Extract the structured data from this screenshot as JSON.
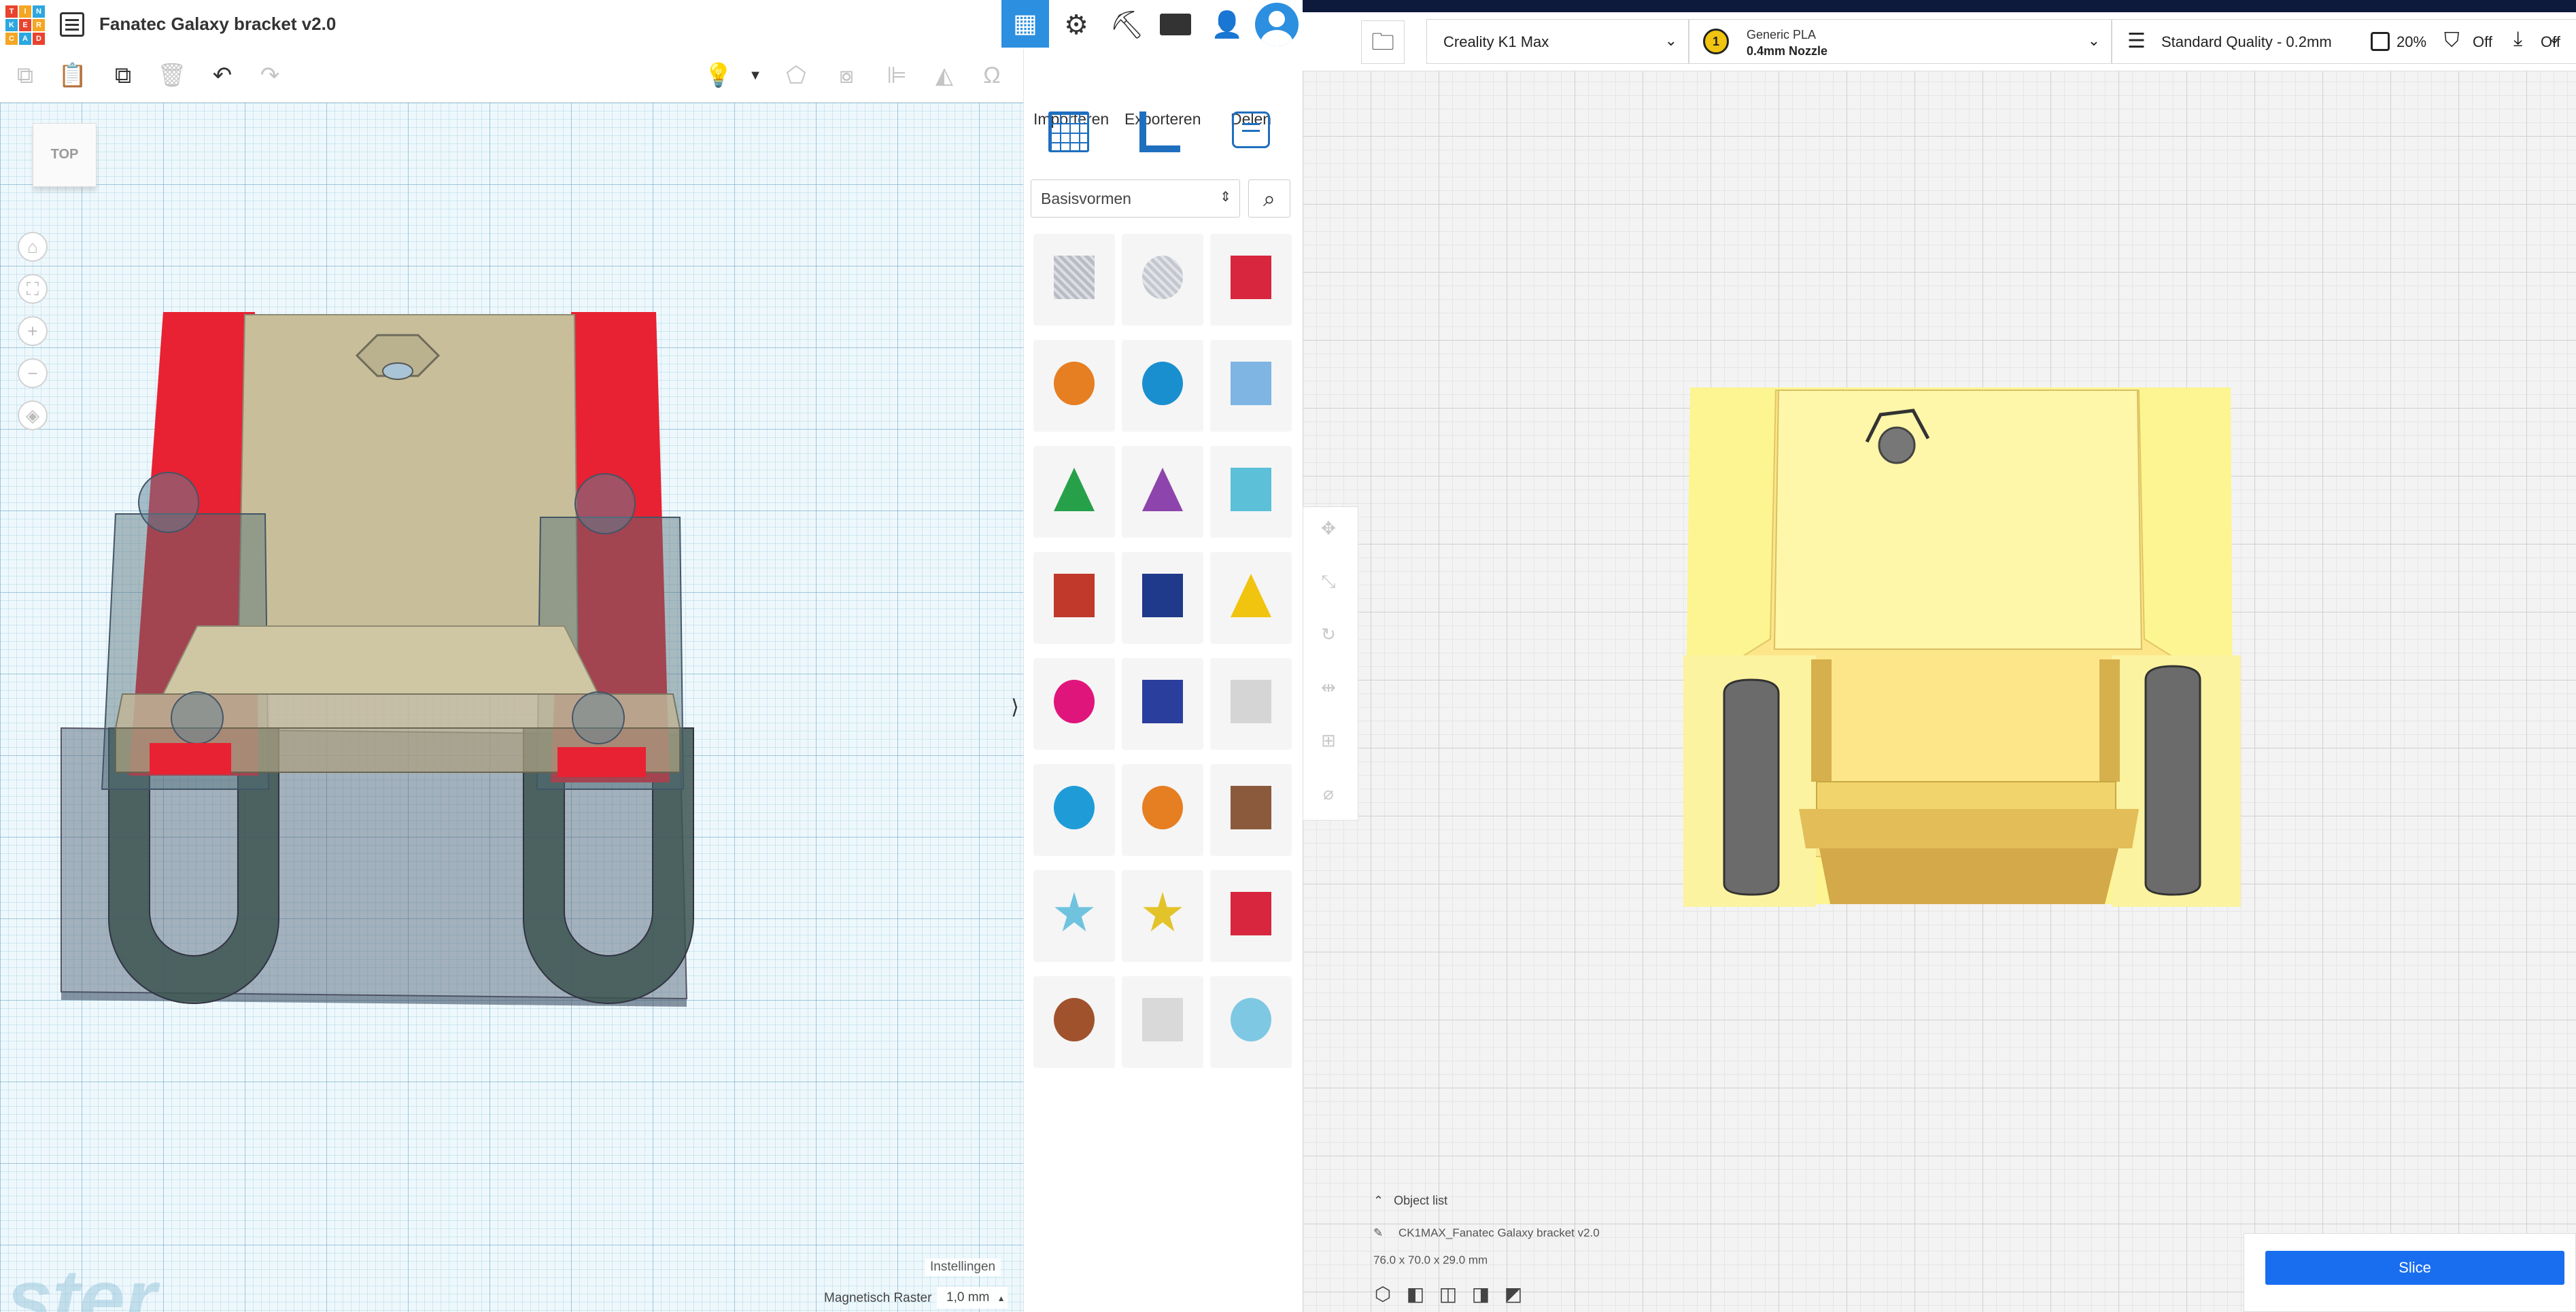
{
  "tinkercad": {
    "logo_letters": [
      "T",
      "I",
      "N",
      "K",
      "E",
      "R",
      "C",
      "A",
      "D"
    ],
    "logo_colors": [
      "#e8432e",
      "#f5a623",
      "#2ca7df",
      "#2ca7df",
      "#e8432e",
      "#f5a623",
      "#f5a623",
      "#2ca7df",
      "#e8432e"
    ],
    "project_title": "Fanatec Galaxy bracket v2.0",
    "menu_icon": "list-icon",
    "header_icons": [
      "grid-view-icon",
      "tinker-gear-icon",
      "pickaxe-icon",
      "bricks-icon",
      "add-user-icon",
      "avatar-icon"
    ],
    "toolbar_icons": [
      "copy-icon",
      "paste-icon",
      "duplicate-icon",
      "delete-icon",
      "undo-icon",
      "redo-icon",
      "light-icon",
      "dropdown-icon",
      "group-icon",
      "ungroup-icon",
      "align-icon",
      "mirror-icon",
      "magnet-icon"
    ],
    "view_cube_label": "TOP",
    "nav_icons": [
      "home-icon",
      "fit-icon",
      "zoom-in-icon",
      "zoom-out-icon",
      "perspective-icon"
    ],
    "panel": {
      "tabs": [
        "Importeren",
        "Exporteren",
        "Delen"
      ],
      "tools": [
        "workplane-icon",
        "ruler-icon",
        "notes-icon"
      ],
      "category": "Basisvormen",
      "search_icon": "search-icon",
      "shapes": [
        {
          "name": "box-hole",
          "color": "#b9bcc6"
        },
        {
          "name": "cylinder-hole",
          "color": "#c4c7cf"
        },
        {
          "name": "box",
          "color": "#d7263d"
        },
        {
          "name": "cylinder",
          "color": "#e67e22"
        },
        {
          "name": "sphere",
          "color": "#1a8fcf"
        },
        {
          "name": "scribble",
          "color": "#7fb5e3"
        },
        {
          "name": "roof",
          "color": "#27a04a"
        },
        {
          "name": "cone",
          "color": "#8e44ad"
        },
        {
          "name": "round-roof",
          "color": "#5bc0d8"
        },
        {
          "name": "text",
          "color": "#c0392b"
        },
        {
          "name": "wedge",
          "color": "#1f3a8a"
        },
        {
          "name": "pyramid",
          "color": "#f1c40f"
        },
        {
          "name": "half-sphere",
          "color": "#e0157c"
        },
        {
          "name": "polygon",
          "color": "#2a3f9d"
        },
        {
          "name": "paraboloid",
          "color": "#d5d5d5"
        },
        {
          "name": "torus",
          "color": "#1f9cd8"
        },
        {
          "name": "tube",
          "color": "#e67e22"
        },
        {
          "name": "heart",
          "color": "#8b5a3c"
        },
        {
          "name": "star",
          "color": "#6fc3df"
        },
        {
          "name": "star-gold",
          "color": "#e3c32a"
        },
        {
          "name": "icosahedron",
          "color": "#d7263d"
        },
        {
          "name": "ring",
          "color": "#a0522d"
        },
        {
          "name": "rounded-box",
          "color": "#d9d9d9"
        },
        {
          "name": "gem",
          "color": "#7ec8e3"
        }
      ],
      "collapse_glyph": "⟩"
    },
    "watermark": "ster",
    "settings_label": "Instellingen",
    "snap_label": "Magnetisch Raster",
    "snap_value": "1,0 mm"
  },
  "cura": {
    "folder_icon": "folder-icon",
    "printer": "Creality K1 Max",
    "material": {
      "extruder": "1",
      "name": "Generic PLA",
      "nozzle": "0.4mm Nozzle"
    },
    "profile": "Standard Quality - 0.2mm",
    "infill": "20%",
    "support": "Off",
    "adhesion": "Off",
    "side_tools": [
      "move-icon",
      "scale-icon",
      "rotate-icon",
      "mirror-icon",
      "per-model-settings-icon",
      "support-blocker-icon"
    ],
    "object_list_label": "Object list",
    "object_name": "CK1MAX_Fanatec Galaxy bracket v2.0",
    "object_dims": "76.0 x 70.0 x 29.0 mm",
    "view_icons": [
      "3d-view-icon",
      "front-view-icon",
      "top-view-icon",
      "left-view-icon",
      "right-view-icon"
    ],
    "slice_label": "Slice",
    "accent": "#196ef0"
  }
}
